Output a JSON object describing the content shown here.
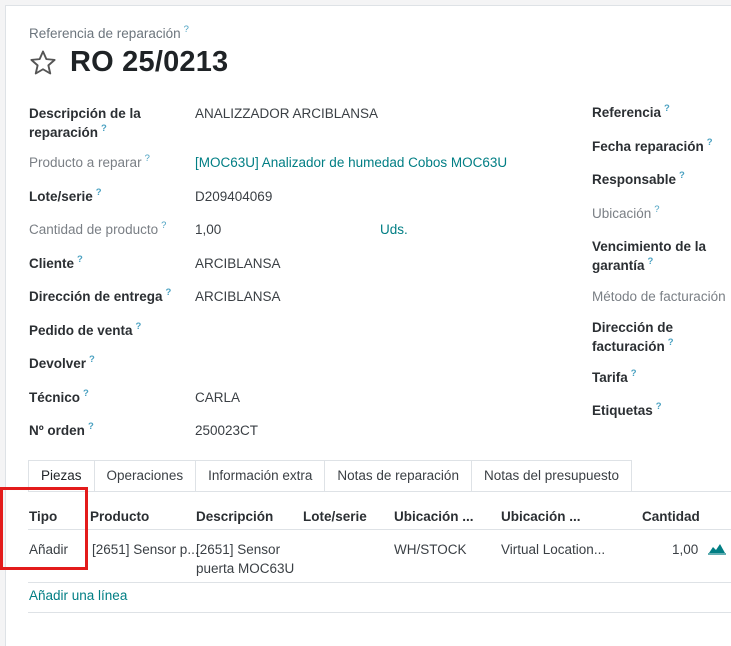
{
  "header": {
    "ref_label": "Referencia de reparación",
    "help": "?",
    "title": "RO 25/0213"
  },
  "left_fields": [
    {
      "label_line1": "Descripción de la",
      "label_line2": "reparación",
      "value": "ANALIZZADOR ARCIBLANSA"
    },
    {
      "label": "Producto a reparar",
      "value": "[MOC63U] Analizador de humedad Cobos MOC63U"
    },
    {
      "label": "Lote/serie",
      "value": "D209404069"
    },
    {
      "label": "Cantidad de producto",
      "value": "1,00",
      "unit": "Uds."
    },
    {
      "label": "Cliente",
      "value": "ARCIBLANSA"
    },
    {
      "label": "Dirección de entrega",
      "value": "ARCIBLANSA"
    },
    {
      "label": "Pedido de venta",
      "value": ""
    },
    {
      "label": "Devolver",
      "value": ""
    },
    {
      "label": "Técnico",
      "value": "CARLA"
    },
    {
      "label": "Nº orden",
      "value": "250023CT"
    }
  ],
  "right_fields": [
    {
      "label": "Referencia"
    },
    {
      "label": "Fecha reparación"
    },
    {
      "label": "Responsable"
    },
    {
      "label": "Ubicación"
    },
    {
      "label_line1": "Vencimiento de la",
      "label_line2": "garantía"
    },
    {
      "label": "Método de facturación"
    },
    {
      "label_line1": "Dirección de",
      "label_line2": "facturación"
    },
    {
      "label": "Tarifa"
    },
    {
      "label": "Etiquetas"
    }
  ],
  "tabs": [
    "Piezas",
    "Operaciones",
    "Información extra",
    "Notas de reparación",
    "Notas del presupuesto"
  ],
  "table": {
    "headers": [
      "Tipo",
      "Producto",
      "Descripción",
      "Lote/serie",
      "Ubicación ...",
      "Ubicación ...",
      "Cantidad"
    ],
    "row": {
      "tipo": "Añadir",
      "producto": "[2651] Sensor p...",
      "descripcion_line1": "[2651] Sensor",
      "descripcion_line2": "puerta MOC63U",
      "lote": "",
      "ubicacion_origen": "WH/STOCK",
      "ubicacion_destino": "Virtual Location...",
      "cantidad": "1,00"
    },
    "add_line": "Añadir una línea"
  },
  "colors": {
    "link": "#017e84",
    "highlight": "#e31b1b",
    "help": "#4aa1c1"
  }
}
